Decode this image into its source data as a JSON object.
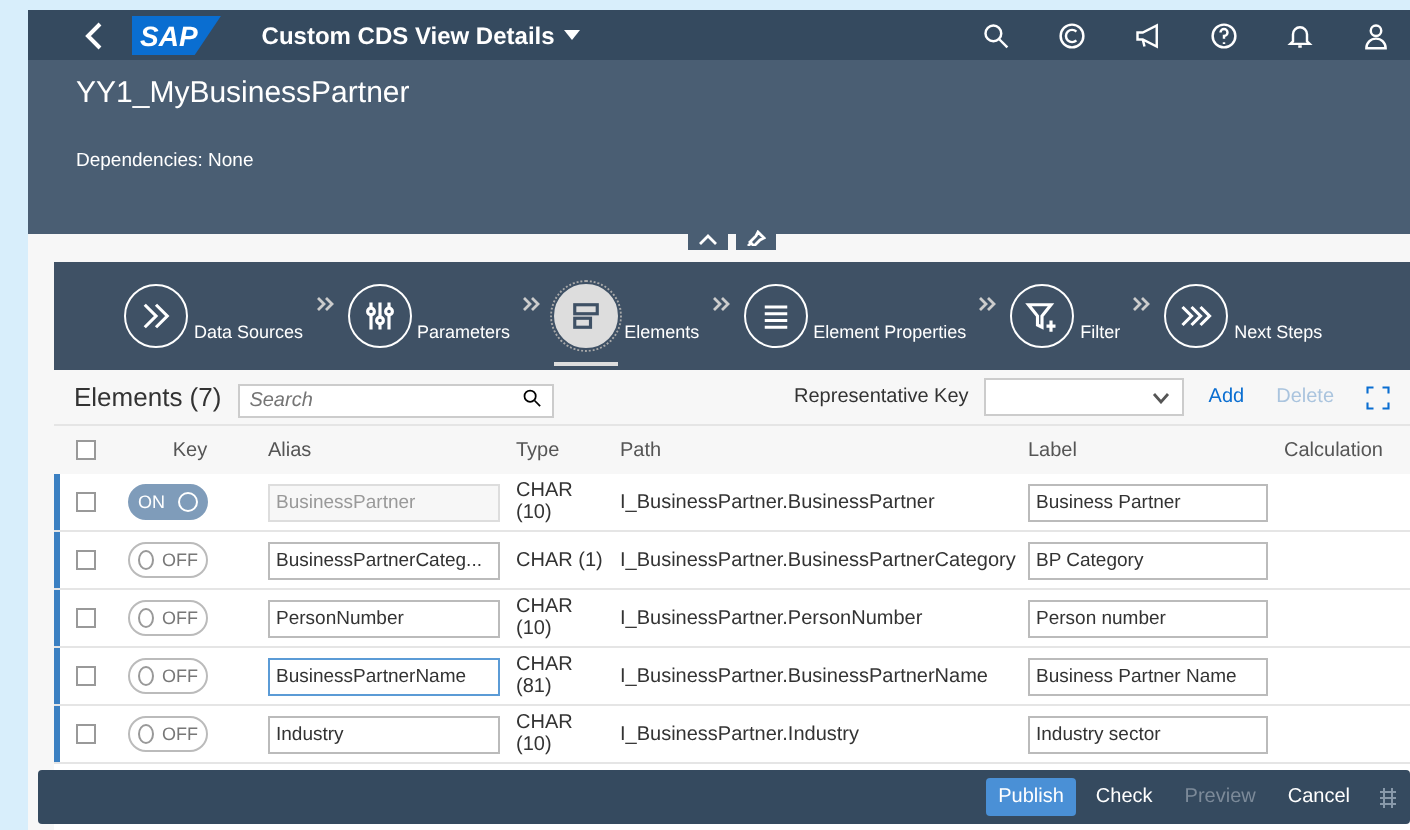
{
  "shell": {
    "logo": "SAP",
    "title": "Custom CDS View Details"
  },
  "header": {
    "title": "YY1_MyBusinessPartner",
    "dependencies": "Dependencies: None"
  },
  "steps": [
    {
      "label": "Data Sources",
      "selected": false
    },
    {
      "label": "Parameters",
      "selected": false
    },
    {
      "label": "Elements",
      "selected": true
    },
    {
      "label": "Element Properties",
      "selected": false
    },
    {
      "label": "Filter",
      "selected": false
    },
    {
      "label": "Next Steps",
      "selected": false
    }
  ],
  "toolbar": {
    "title": "Elements (7)",
    "search_placeholder": "Search",
    "representative_key_label": "Representative Key",
    "add": "Add",
    "delete": "Delete",
    "delete_disabled": true
  },
  "table": {
    "all_checked": false,
    "columns": [
      "Key",
      "Alias",
      "Type",
      "Path",
      "Label",
      "Calculation"
    ],
    "rows": [
      {
        "checked": false,
        "key": true,
        "key_text": "ON",
        "alias": "BusinessPartner",
        "alias_disabled": true,
        "alias_focused": false,
        "type": "CHAR (10)",
        "path": "I_BusinessPartner.BusinessPartner",
        "label": "Business Partner"
      },
      {
        "checked": false,
        "key": false,
        "key_text": "OFF",
        "alias": "BusinessPartnerCateg...",
        "alias_disabled": false,
        "alias_focused": false,
        "type": "CHAR (1)",
        "path": "I_BusinessPartner.BusinessPartnerCategory",
        "label": "BP Category"
      },
      {
        "checked": false,
        "key": false,
        "key_text": "OFF",
        "alias": "PersonNumber",
        "alias_disabled": false,
        "alias_focused": false,
        "type": "CHAR (10)",
        "path": "I_BusinessPartner.PersonNumber",
        "label": "Person number"
      },
      {
        "checked": false,
        "key": false,
        "key_text": "OFF",
        "alias": "BusinessPartnerName",
        "alias_disabled": false,
        "alias_focused": true,
        "type": "CHAR (81)",
        "path": "I_BusinessPartner.BusinessPartnerName",
        "label": "Business Partner Name"
      },
      {
        "checked": false,
        "key": false,
        "key_text": "OFF",
        "alias": "Industry",
        "alias_disabled": false,
        "alias_focused": false,
        "type": "CHAR (10)",
        "path": "I_BusinessPartner.Industry",
        "label": "Industry sector"
      }
    ]
  },
  "footer": [
    {
      "label": "Publish",
      "kind": "emphasized"
    },
    {
      "label": "Check",
      "kind": "normal"
    },
    {
      "label": "Preview",
      "kind": "disabled"
    },
    {
      "label": "Cancel",
      "kind": "normal"
    }
  ]
}
